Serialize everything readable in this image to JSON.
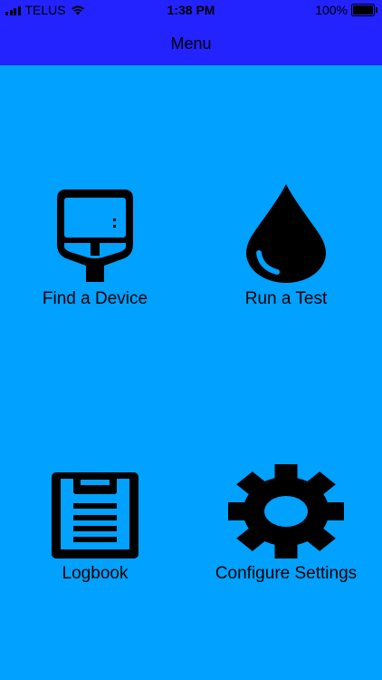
{
  "status_bar": {
    "carrier": "TELUS",
    "time": "1:38 PM",
    "battery_percent": "100%",
    "battery_level": 1.0,
    "signal_bars": 4,
    "wifi": true
  },
  "nav": {
    "title": "Menu"
  },
  "menu": {
    "items": [
      {
        "label": "Find a Device",
        "icon": "glucose-meter-icon"
      },
      {
        "label": "Run a Test",
        "icon": "blood-drop-icon"
      },
      {
        "label": "Logbook",
        "icon": "clipboard-icon"
      },
      {
        "label": "Configure Settings",
        "icon": "gear-icon"
      }
    ]
  },
  "colors": {
    "background": "#00a1ff",
    "header": "#2323ff",
    "foreground": "#000000"
  }
}
